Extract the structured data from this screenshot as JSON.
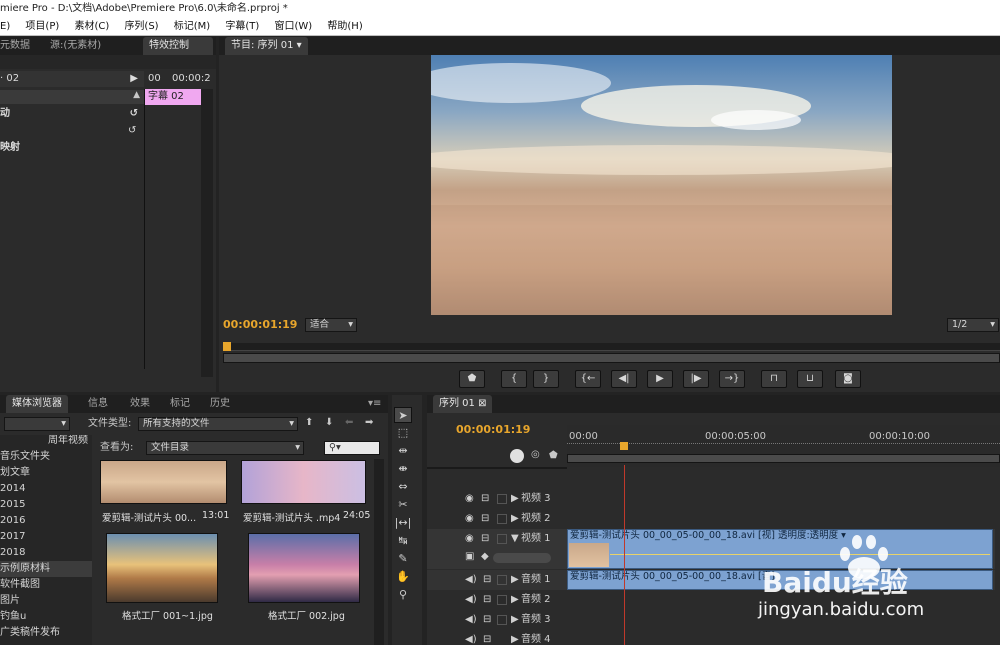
{
  "window": {
    "title": "miere Pro - D:\\文档\\Adobe\\Premiere Pro\\6.0\\未命名.prproj *"
  },
  "menu": [
    "E)",
    "项目(P)",
    "素材(C)",
    "序列(S)",
    "标记(M)",
    "字幕(T)",
    "窗口(W)",
    "帮助(H)"
  ],
  "top_left_panel": {
    "tabs": [
      "元数据",
      "源:(无素材)",
      "特效控制"
    ],
    "clip_name": "· 02",
    "timecode_col": [
      "00",
      "00:00:2"
    ],
    "rows": [
      "动",
      "映射"
    ],
    "title_clip": "字幕 02"
  },
  "program_monitor": {
    "tab": "节目: 序列 01",
    "timecode": "00:00:01:19",
    "zoom": "适合",
    "resolution": "1/2",
    "playhead_frac": 0.0,
    "transport": [
      "marker-icon",
      "in-point-icon",
      "out-point-icon",
      "goto-in-icon",
      "step-back-icon",
      "play-icon",
      "step-forward-icon",
      "goto-out-icon",
      "lift-icon",
      "extract-icon",
      "export-frame-icon"
    ]
  },
  "media_browser": {
    "tabs": [
      "媒体浏览器",
      "信息",
      "效果",
      "标记",
      "历史"
    ],
    "file_type_label": "文件类型:",
    "file_type_value": "所有支持的文件",
    "view_as_label": "查看为:",
    "view_as_value": "文件目录",
    "folders": [
      "周年视频",
      "音乐文件夹",
      "划文章",
      "2014",
      "2015",
      "2016",
      "2017",
      "2018",
      "示例原材料",
      "软件截图",
      "图片",
      "钓鱼u",
      "广类稿件发布"
    ],
    "thumbnails": [
      {
        "name": "爱剪辑-测试片头 00...",
        "duration": "13:01"
      },
      {
        "name": "爱剪辑-测试片头 .mp4",
        "duration": "24:05"
      },
      {
        "name": "格式工厂 001~1.jpg",
        "duration": ""
      },
      {
        "name": "格式工厂 002.jpg",
        "duration": ""
      }
    ]
  },
  "timeline": {
    "tab": "序列 01",
    "timecode": "00:00:01:19",
    "ruler": [
      "00:00",
      "00:00:05:00",
      "00:00:10:00"
    ],
    "tracks": [
      {
        "name": "视频 3",
        "type": "video"
      },
      {
        "name": "视频 2",
        "type": "video"
      },
      {
        "name": "视频 1",
        "type": "video"
      },
      {
        "name": "音频 1",
        "type": "audio"
      },
      {
        "name": "音频 2",
        "type": "audio"
      },
      {
        "name": "音频 3",
        "type": "audio"
      },
      {
        "name": "音频 4",
        "type": "audio"
      }
    ],
    "video_clip": "爱剪辑-测试片头 00_00_05-00_00_18.avi [视] 透明度:透明度 ▾",
    "audio_clip": "爱剪辑-测试片头 00_00_05-00_00_18.avi [音]"
  },
  "watermark": {
    "line1": "Baidu经验",
    "line2": "jingyan.baidu.com"
  },
  "colors": {
    "accent": "#e8a62c",
    "clip": "#7da2d1",
    "title_clip": "#f0a8f0"
  }
}
